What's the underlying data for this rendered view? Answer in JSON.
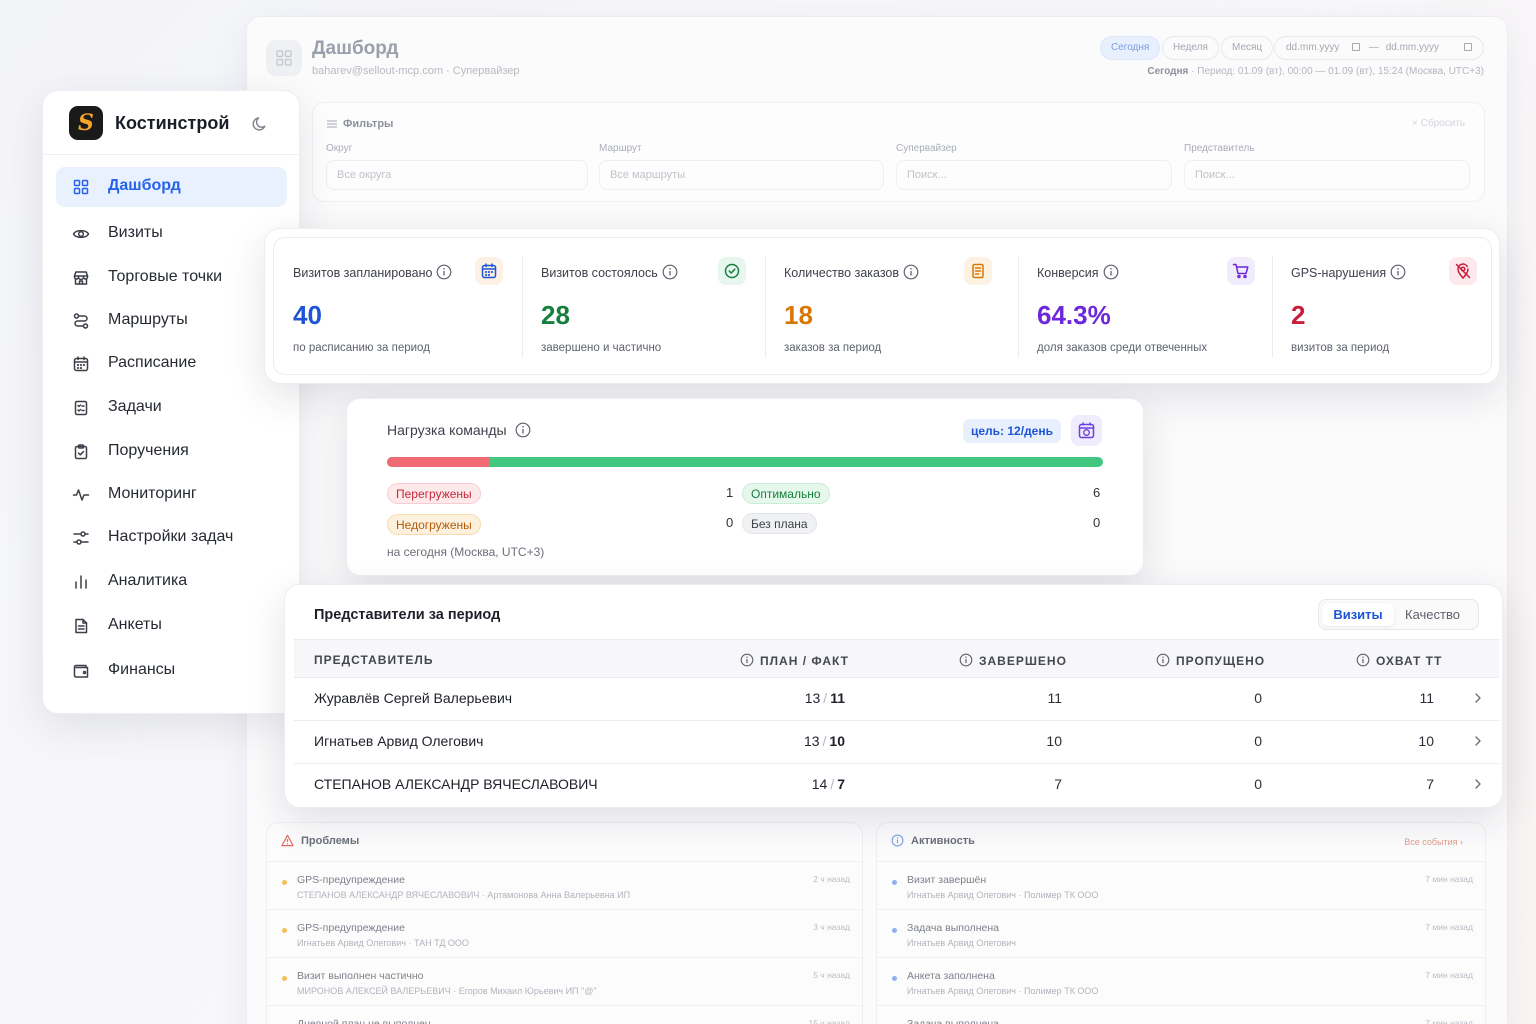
{
  "header": {
    "title": "Дашборд",
    "subtitle": "baharev@sellout-mcp.com · Супервайзер",
    "periods": [
      "Сегодня",
      "Неделя",
      "Месяц"
    ],
    "date_from": "dd.mm.yyyy",
    "date_sep": "—",
    "date_to": "dd.mm.yyyy",
    "period_label": "Сегодня",
    "period_text": "· Период: 01.09 (вт), 00:00 — 01.09 (вт), 15:24 (Москва, UTC+3)"
  },
  "filters": {
    "title": "Фильтры",
    "reset": "Сбросить",
    "okrug_label": "Округ",
    "okrug_value": "Все округа",
    "route_label": "Маршрут",
    "route_value": "Все маршруты",
    "supervisor_label": "Супервайзер",
    "supervisor_placeholder": "Поиск...",
    "rep_label": "Представитель",
    "rep_placeholder": "Поиск..."
  },
  "sidebar": {
    "brand": "Костинстрой",
    "logo_letter": "S",
    "items": [
      {
        "label": "Дашборд",
        "icon": "grid-icon",
        "active": true
      },
      {
        "label": "Визиты",
        "icon": "eye-icon"
      },
      {
        "label": "Торговые точки",
        "icon": "store-icon"
      },
      {
        "label": "Маршруты",
        "icon": "route-icon"
      },
      {
        "label": "Расписание",
        "icon": "calendar-icon"
      },
      {
        "label": "Задачи",
        "icon": "checklist-icon"
      },
      {
        "label": "Поручения",
        "icon": "clipboard-check-icon"
      },
      {
        "label": "Мониторинг",
        "icon": "activity-icon"
      },
      {
        "label": "Настройки задач",
        "icon": "settings-sliders-icon"
      },
      {
        "label": "Аналитика",
        "icon": "bar-chart-icon"
      },
      {
        "label": "Анкеты",
        "icon": "document-icon"
      },
      {
        "label": "Финансы",
        "icon": "wallet-icon"
      }
    ]
  },
  "kpis": [
    {
      "label": "Визитов запланировано",
      "value": "40",
      "caption": "по расписанию за период",
      "color": "#1d55d6",
      "icon": "calendar-icon",
      "icon_bg": "#fdf1e6"
    },
    {
      "label": "Визитов состоялось",
      "value": "28",
      "caption": "завершено и частично",
      "color": "#15803d",
      "icon": "check-circle-icon",
      "icon_bg": "#e7f6ee"
    },
    {
      "label": "Количество заказов",
      "value": "18",
      "caption": "заказов за период",
      "color": "#d97706",
      "icon": "receipt-icon",
      "icon_bg": "#fdf1e2"
    },
    {
      "label": "Конверсия",
      "value": "64.3%",
      "caption": "доля заказов среди отвеченных",
      "color": "#6d28d9",
      "icon": "cart-icon",
      "icon_bg": "#f1ecfd"
    },
    {
      "label": "GPS-нарушения",
      "value": "2",
      "caption": "визитов за период",
      "color": "#c81e3a",
      "icon": "location-off-icon",
      "icon_bg": "#fde9ec"
    }
  ],
  "load": {
    "title": "Нагрузка команды",
    "goal": "цель: 12/день",
    "overloaded_label": "Перегружены",
    "overloaded_count": "1",
    "underloaded_label": "Недогружены",
    "underloaded_count": "0",
    "optimal_label": "Оптимально",
    "optimal_count": "6",
    "noplan_label": "Без плана",
    "noplan_count": "0",
    "overloaded_fraction": 0.143,
    "note": "на сегодня (Москва, UTC+3)"
  },
  "reps": {
    "title": "Представители за период",
    "tabs": [
      "Визиты",
      "Качество"
    ],
    "columns": [
      "ПРЕДСТАВИТЕЛЬ",
      "ПЛАН / ФАКТ",
      "ЗАВЕРШЕНО",
      "ПРОПУЩЕНО",
      "ОХВАТ ТТ"
    ],
    "rows": [
      {
        "name": "Журавлёв Сергей Валерьевич",
        "plan": "13",
        "fact": "11",
        "done": "11",
        "missed": "0",
        "cover": "11"
      },
      {
        "name": "Игнатьев Арвид Олегович",
        "plan": "13",
        "fact": "10",
        "done": "10",
        "missed": "0",
        "cover": "10"
      },
      {
        "name": "СТЕПАНОВ АЛЕКСАНДР ВЯЧЕСЛАВОВИЧ",
        "plan": "14",
        "fact": "7",
        "done": "7",
        "missed": "0",
        "cover": "7"
      }
    ]
  },
  "problems": {
    "title": "Проблемы",
    "items": [
      {
        "title": "GPS-предупреждение",
        "sub": "СТЕПАНОВ АЛЕКСАНДР ВЯЧЕСЛАВОВИЧ · Артамонова Анна Валерьевна ИП",
        "time": "2 ч назад"
      },
      {
        "title": "GPS-предупреждение",
        "sub": "Игнатьев Арвид Олегович · ТАН ТД ООО",
        "time": "3 ч назад"
      },
      {
        "title": "Визит выполнен частично",
        "sub": "МИРОНОВ АЛЕКСЕЙ ВАЛЕРЬЕВИЧ · Егоров Михаил Юрьевич ИП \"@\"",
        "time": "5 ч назад"
      },
      {
        "title": "Дневной план не выполнен",
        "sub": "",
        "time": "15 ч назад"
      }
    ]
  },
  "activity": {
    "title": "Активность",
    "all_events": "Все события",
    "items": [
      {
        "title": "Визит завершён",
        "sub": "Игнатьев Арвид Олегович · Полимер ТК ООО",
        "time": "7 мин назад"
      },
      {
        "title": "Задача выполнена",
        "sub": "Игнатьев Арвид Олегович",
        "time": "7 мин назад"
      },
      {
        "title": "Анкета заполнена",
        "sub": "Игнатьев Арвид Олегович · Полимер ТК ООО",
        "time": "7 мин назад"
      },
      {
        "title": "Задача выполнена",
        "sub": "",
        "time": "7 мин назад"
      }
    ]
  }
}
